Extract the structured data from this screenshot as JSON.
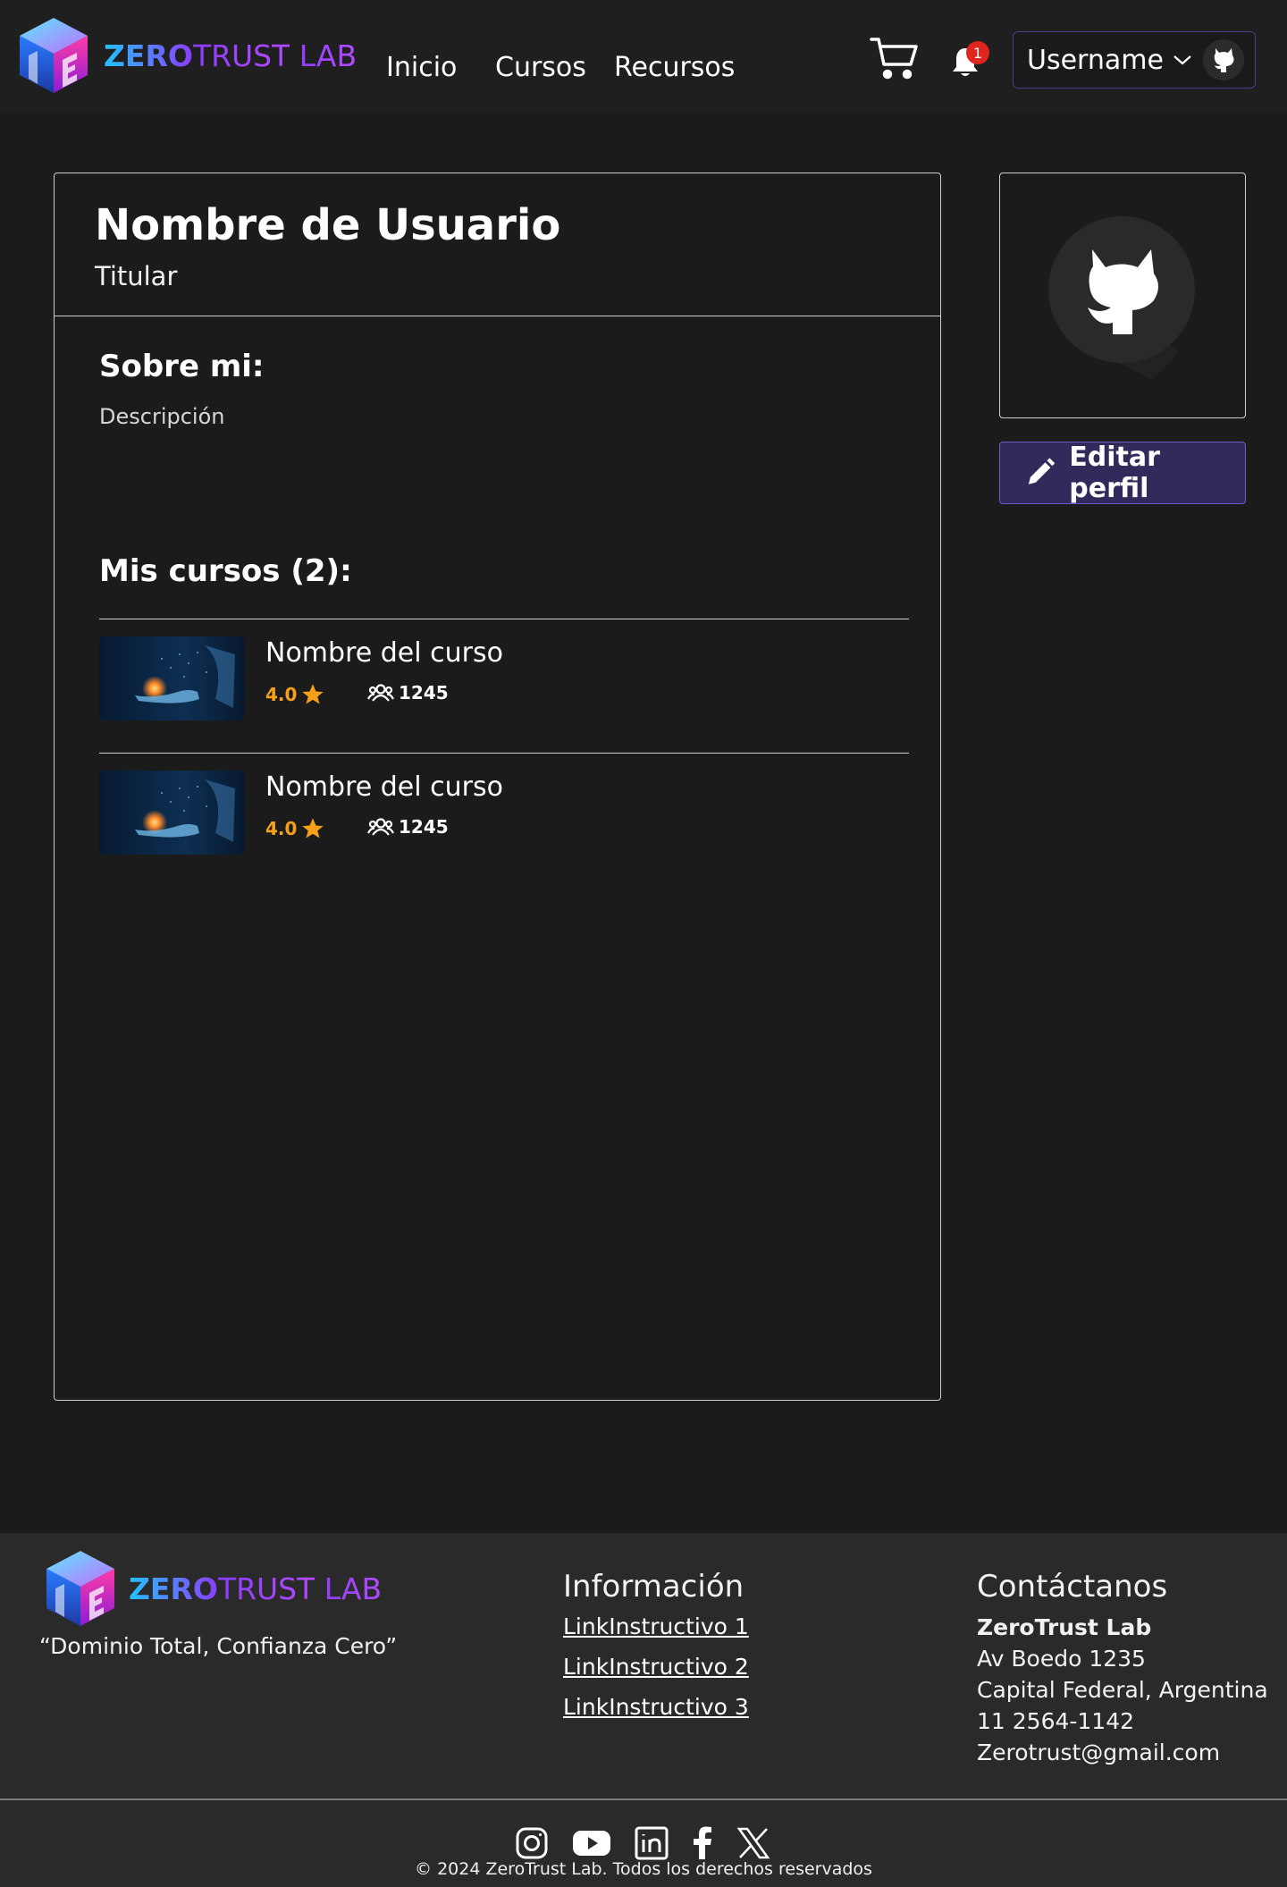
{
  "header": {
    "logo": {
      "word1": "ZERO",
      "word2": "TRUST",
      "word3": " LAB"
    },
    "nav": [
      {
        "label": "Inicio"
      },
      {
        "label": "Cursos"
      },
      {
        "label": "Recursos"
      }
    ],
    "cart_icon": "shopping-cart-icon",
    "bell_icon": "bell-icon",
    "notification_count": "1",
    "user_menu": {
      "username": "Username",
      "chevron_icon": "chevron-down-icon",
      "avatar_icon": "github-icon"
    }
  },
  "profile": {
    "name": "Nombre de Usuario",
    "headline": "Titular",
    "about_title": "Sobre mi:",
    "about_text": "Descripción",
    "courses_title": "Mis cursos (2):",
    "courses": [
      {
        "name": "Nombre del curso",
        "rating": "4.0",
        "students": "1245"
      },
      {
        "name": "Nombre del curso",
        "rating": "4.0",
        "students": "1245"
      }
    ],
    "edit_button": "Editar perfil"
  },
  "footer": {
    "slogan": "“Dominio Total, Confianza Cero”",
    "info": {
      "title": "Información",
      "links": [
        "LinkInstructivo 1",
        "LinkInstructivo 2",
        "LinkInstructivo 3"
      ]
    },
    "contact": {
      "title": "Contáctanos",
      "company": "ZeroTrust Lab",
      "address": "Av Boedo 1235",
      "city": "Capital Federal, Argentina",
      "phone": "11 2564-1142",
      "email": "Zerotrust@gmail.com"
    },
    "socials": [
      "instagram-icon",
      "youtube-icon",
      "linkedin-icon",
      "facebook-icon",
      "x-icon"
    ],
    "copyright": "© 2024 ZeroTrust Lab. Todos los derechos reservados"
  },
  "colors": {
    "background": "#1b1b1c",
    "header": "#1f1f20",
    "footer": "#2a2a2b",
    "accent": "#322a5a",
    "rating": "#f6a01a",
    "badge": "#e0241f"
  }
}
